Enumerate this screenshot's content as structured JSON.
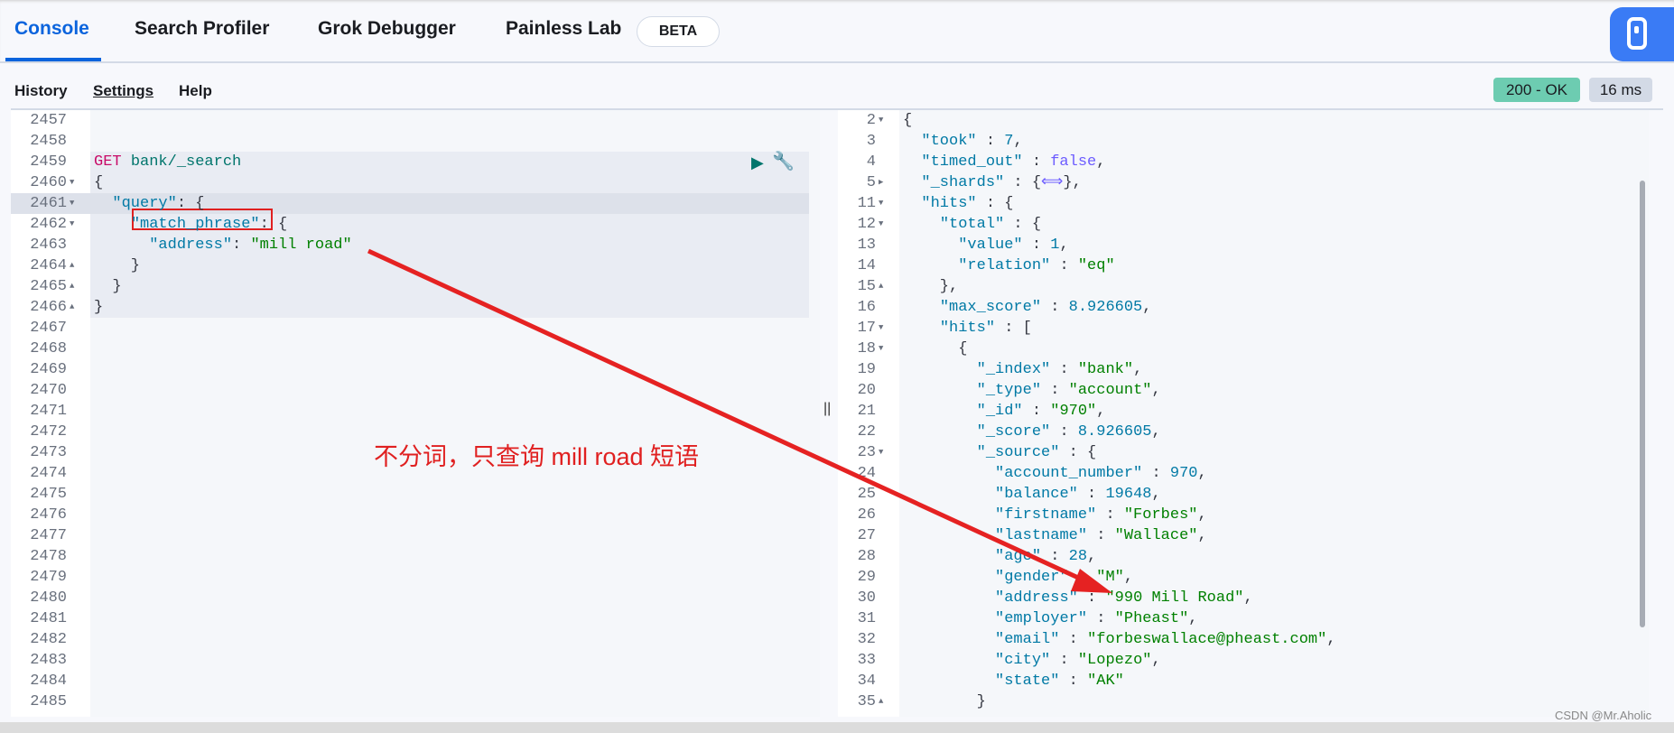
{
  "tabs": [
    {
      "label": "Console",
      "active": true
    },
    {
      "label": "Search Profiler"
    },
    {
      "label": "Grok Debugger"
    },
    {
      "label": "Painless Lab"
    }
  ],
  "beta_label": "BETA",
  "menu": {
    "history": "History",
    "settings": "Settings",
    "help": "Help"
  },
  "status": {
    "code": "200 - OK",
    "time": "16 ms",
    "ok_color": "#6dccb1"
  },
  "annotation": "不分词，只查询 mill road 短语",
  "watermark": "CSDN @Mr.Aholic",
  "request": {
    "lines": [
      {
        "n": "2457",
        "t": []
      },
      {
        "n": "2458",
        "t": []
      },
      {
        "n": "2459",
        "t": [
          [
            "m",
            "GET"
          ],
          [
            "p",
            " "
          ],
          [
            "u",
            "bank/_search"
          ]
        ]
      },
      {
        "n": "2460",
        "f": "d",
        "t": [
          [
            "p",
            "{"
          ]
        ]
      },
      {
        "n": "2461",
        "f": "d",
        "t": [
          [
            "p",
            "  "
          ],
          [
            "k",
            "\"query\""
          ],
          [
            "p",
            ": {"
          ]
        ]
      },
      {
        "n": "2462",
        "f": "d",
        "t": [
          [
            "p",
            "    "
          ],
          [
            "k",
            "\"match_phrase\""
          ],
          [
            "p",
            ": {"
          ]
        ]
      },
      {
        "n": "2463",
        "t": [
          [
            "p",
            "      "
          ],
          [
            "k",
            "\"address\""
          ],
          [
            "p",
            ": "
          ],
          [
            "s",
            "\"mill road\""
          ]
        ]
      },
      {
        "n": "2464",
        "f": "u",
        "t": [
          [
            "p",
            "    }"
          ]
        ]
      },
      {
        "n": "2465",
        "f": "u",
        "t": [
          [
            "p",
            "  }"
          ]
        ]
      },
      {
        "n": "2466",
        "f": "u",
        "t": [
          [
            "p",
            "}"
          ]
        ]
      },
      {
        "n": "2467",
        "t": []
      },
      {
        "n": "2468",
        "t": []
      },
      {
        "n": "2469",
        "t": []
      },
      {
        "n": "2470",
        "t": []
      },
      {
        "n": "2471",
        "t": []
      },
      {
        "n": "2472",
        "t": []
      },
      {
        "n": "2473",
        "t": []
      },
      {
        "n": "2474",
        "t": []
      },
      {
        "n": "2475",
        "t": []
      },
      {
        "n": "2476",
        "t": []
      },
      {
        "n": "2477",
        "t": []
      },
      {
        "n": "2478",
        "t": []
      },
      {
        "n": "2479",
        "t": []
      },
      {
        "n": "2480",
        "t": []
      },
      {
        "n": "2481",
        "t": []
      },
      {
        "n": "2482",
        "t": []
      },
      {
        "n": "2483",
        "t": []
      },
      {
        "n": "2484",
        "t": []
      },
      {
        "n": "2485",
        "t": []
      }
    ]
  },
  "response": {
    "lines": [
      {
        "n": "2",
        "f": "d",
        "t": [
          [
            "p",
            "{"
          ]
        ]
      },
      {
        "n": "3",
        "t": [
          [
            "p",
            "  "
          ],
          [
            "k",
            "\"took\""
          ],
          [
            "p",
            " : "
          ],
          [
            "n",
            "7"
          ],
          [
            "p",
            ","
          ]
        ]
      },
      {
        "n": "4",
        "t": [
          [
            "p",
            "  "
          ],
          [
            "k",
            "\"timed_out\""
          ],
          [
            "p",
            " : "
          ],
          [
            "b",
            "false"
          ],
          [
            "p",
            ","
          ]
        ]
      },
      {
        "n": "5",
        "f": "r",
        "t": [
          [
            "p",
            "  "
          ],
          [
            "k",
            "\"_shards\""
          ],
          [
            "p",
            " : {"
          ],
          [
            "b",
            "⟺"
          ],
          [
            "p",
            "},"
          ]
        ]
      },
      {
        "n": "11",
        "f": "d",
        "t": [
          [
            "p",
            "  "
          ],
          [
            "k",
            "\"hits\""
          ],
          [
            "p",
            " : {"
          ]
        ]
      },
      {
        "n": "12",
        "f": "d",
        "t": [
          [
            "p",
            "    "
          ],
          [
            "k",
            "\"total\""
          ],
          [
            "p",
            " : {"
          ]
        ]
      },
      {
        "n": "13",
        "t": [
          [
            "p",
            "      "
          ],
          [
            "k",
            "\"value\""
          ],
          [
            "p",
            " : "
          ],
          [
            "n",
            "1"
          ],
          [
            "p",
            ","
          ]
        ]
      },
      {
        "n": "14",
        "t": [
          [
            "p",
            "      "
          ],
          [
            "k",
            "\"relation\""
          ],
          [
            "p",
            " : "
          ],
          [
            "s",
            "\"eq\""
          ]
        ]
      },
      {
        "n": "15",
        "f": "u",
        "t": [
          [
            "p",
            "    },"
          ]
        ]
      },
      {
        "n": "16",
        "t": [
          [
            "p",
            "    "
          ],
          [
            "k",
            "\"max_score\""
          ],
          [
            "p",
            " : "
          ],
          [
            "n",
            "8.926605"
          ],
          [
            "p",
            ","
          ]
        ]
      },
      {
        "n": "17",
        "f": "d",
        "t": [
          [
            "p",
            "    "
          ],
          [
            "k",
            "\"hits\""
          ],
          [
            "p",
            " : ["
          ]
        ]
      },
      {
        "n": "18",
        "f": "d",
        "t": [
          [
            "p",
            "      {"
          ]
        ]
      },
      {
        "n": "19",
        "t": [
          [
            "p",
            "        "
          ],
          [
            "k",
            "\"_index\""
          ],
          [
            "p",
            " : "
          ],
          [
            "s",
            "\"bank\""
          ],
          [
            "p",
            ","
          ]
        ]
      },
      {
        "n": "20",
        "t": [
          [
            "p",
            "        "
          ],
          [
            "k",
            "\"_type\""
          ],
          [
            "p",
            " : "
          ],
          [
            "s",
            "\"account\""
          ],
          [
            "p",
            ","
          ]
        ]
      },
      {
        "n": "21",
        "t": [
          [
            "p",
            "        "
          ],
          [
            "k",
            "\"_id\""
          ],
          [
            "p",
            " : "
          ],
          [
            "s",
            "\"970\""
          ],
          [
            "p",
            ","
          ]
        ]
      },
      {
        "n": "22",
        "t": [
          [
            "p",
            "        "
          ],
          [
            "k",
            "\"_score\""
          ],
          [
            "p",
            " : "
          ],
          [
            "n",
            "8.926605"
          ],
          [
            "p",
            ","
          ]
        ]
      },
      {
        "n": "23",
        "f": "d",
        "t": [
          [
            "p",
            "        "
          ],
          [
            "k",
            "\"_source\""
          ],
          [
            "p",
            " : {"
          ]
        ]
      },
      {
        "n": "24",
        "t": [
          [
            "p",
            "          "
          ],
          [
            "k",
            "\"account_number\""
          ],
          [
            "p",
            " : "
          ],
          [
            "n",
            "970"
          ],
          [
            "p",
            ","
          ]
        ]
      },
      {
        "n": "25",
        "t": [
          [
            "p",
            "          "
          ],
          [
            "k",
            "\"balance\""
          ],
          [
            "p",
            " : "
          ],
          [
            "n",
            "19648"
          ],
          [
            "p",
            ","
          ]
        ]
      },
      {
        "n": "26",
        "t": [
          [
            "p",
            "          "
          ],
          [
            "k",
            "\"firstname\""
          ],
          [
            "p",
            " : "
          ],
          [
            "s",
            "\"Forbes\""
          ],
          [
            "p",
            ","
          ]
        ]
      },
      {
        "n": "27",
        "t": [
          [
            "p",
            "          "
          ],
          [
            "k",
            "\"lastname\""
          ],
          [
            "p",
            " : "
          ],
          [
            "s",
            "\"Wallace\""
          ],
          [
            "p",
            ","
          ]
        ]
      },
      {
        "n": "28",
        "t": [
          [
            "p",
            "          "
          ],
          [
            "k",
            "\"age\""
          ],
          [
            "p",
            " : "
          ],
          [
            "n",
            "28"
          ],
          [
            "p",
            ","
          ]
        ]
      },
      {
        "n": "29",
        "t": [
          [
            "p",
            "          "
          ],
          [
            "k",
            "\"gender\""
          ],
          [
            "p",
            " : "
          ],
          [
            "s",
            "\"M\""
          ],
          [
            "p",
            ","
          ]
        ]
      },
      {
        "n": "30",
        "t": [
          [
            "p",
            "          "
          ],
          [
            "k",
            "\"address\""
          ],
          [
            "p",
            " : "
          ],
          [
            "s",
            "\"990 Mill Road\""
          ],
          [
            "p",
            ","
          ]
        ]
      },
      {
        "n": "31",
        "t": [
          [
            "p",
            "          "
          ],
          [
            "k",
            "\"employer\""
          ],
          [
            "p",
            " : "
          ],
          [
            "s",
            "\"Pheast\""
          ],
          [
            "p",
            ","
          ]
        ]
      },
      {
        "n": "32",
        "t": [
          [
            "p",
            "          "
          ],
          [
            "k",
            "\"email\""
          ],
          [
            "p",
            " : "
          ],
          [
            "s",
            "\"forbeswallace@pheast.com\""
          ],
          [
            "p",
            ","
          ]
        ]
      },
      {
        "n": "33",
        "t": [
          [
            "p",
            "          "
          ],
          [
            "k",
            "\"city\""
          ],
          [
            "p",
            " : "
          ],
          [
            "s",
            "\"Lopezo\""
          ],
          [
            "p",
            ","
          ]
        ]
      },
      {
        "n": "34",
        "t": [
          [
            "p",
            "          "
          ],
          [
            "k",
            "\"state\""
          ],
          [
            "p",
            " : "
          ],
          [
            "s",
            "\"AK\""
          ]
        ]
      },
      {
        "n": "35",
        "f": "u",
        "t": [
          [
            "p",
            "        }"
          ]
        ]
      }
    ]
  }
}
